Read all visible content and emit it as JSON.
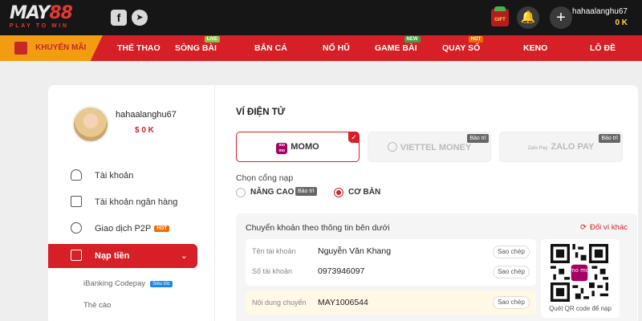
{
  "header": {
    "logo_main_a": "MAY",
    "logo_main_b": "88",
    "logo_tagline": "PLAY TO WIN",
    "social": [
      {
        "icon": "facebook-icon",
        "glyph": "f"
      },
      {
        "icon": "telegram-icon",
        "glyph": "➤"
      }
    ],
    "gift_label": "GIFT BOX",
    "username": "hahaalanghu67",
    "balance": "0 K"
  },
  "nav": {
    "promo_label": "KHUYẾN MÃI",
    "items": [
      {
        "label": "THỂ THAO",
        "badge": ""
      },
      {
        "label": "SÒNG BÀI",
        "badge": "LIVE"
      },
      {
        "label": "BẮN CÁ",
        "badge": ""
      },
      {
        "label": "NỔ HŨ",
        "badge": ""
      },
      {
        "label": "GAME BÀI",
        "badge": "NEW"
      },
      {
        "label": "QUAY SỐ",
        "badge": "HOT"
      },
      {
        "label": "KENO",
        "badge": ""
      },
      {
        "label": "LÔ ĐỀ",
        "badge": ""
      }
    ]
  },
  "sidebar": {
    "username": "hahaalanghu67",
    "balance": "$ 0 K",
    "items": [
      {
        "label": "Tài khoản",
        "icon": "user-icon"
      },
      {
        "label": "Tài khoản ngân hàng",
        "icon": "bank-icon"
      },
      {
        "label": "Giao dịch P2P",
        "icon": "p2p-icon",
        "tag": "HOT"
      },
      {
        "label": "Nạp tiền",
        "icon": "deposit-icon",
        "active": true
      }
    ],
    "sub_items": [
      {
        "label": "iBanking Codepay",
        "tag": "Siêu tốc"
      },
      {
        "label": "Thẻ cào"
      }
    ]
  },
  "content": {
    "section_title": "VÍ ĐIỆN TỬ",
    "wallets": [
      {
        "label": "MOMO",
        "selected": true,
        "icon_text": "mo mo"
      },
      {
        "label": "VIETTEL MONEY",
        "tag": "Bảo trì"
      },
      {
        "label": "ZALO PAY",
        "tag": "Bảo trì",
        "icon_text": "Zalo Pay"
      }
    ],
    "gate_label": "Chọn cổng nạp",
    "gates": [
      {
        "label": "NÂNG CAO",
        "tag": "Bảo trì",
        "selected": false
      },
      {
        "label": "CƠ BẢN",
        "selected": true
      }
    ],
    "transfer": {
      "title": "Chuyển khoản theo thông tin bên dưới",
      "switch_label": "Đổi ví khác",
      "rows": [
        {
          "label": "Tên tài khoản",
          "value": "Nguyễn Văn Khang",
          "button": "Sao chép"
        },
        {
          "label": "Số tài khoản",
          "value": "0973946097",
          "button": "Sao chép"
        }
      ],
      "memo": {
        "label": "Nội dung chuyển",
        "value": "MAY1006544",
        "button": "Sao chép"
      },
      "qr_caption": "Quét QR code để nạp",
      "qr_center_text": "mo mo"
    }
  },
  "colors": {
    "brand_red": "#d61f26",
    "promo_orange": "#f39c12",
    "momo_purple": "#a50064",
    "balance_yellow": "#ffd54f"
  }
}
